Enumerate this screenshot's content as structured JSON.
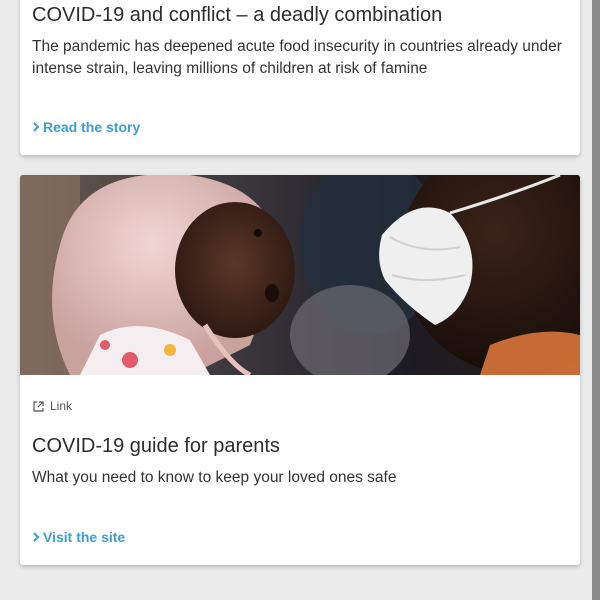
{
  "card_conflict": {
    "title": "COVID-19 and conflict – a deadly combination",
    "description": "The pandemic has deepened acute food insecurity in countries already under intense strain, leaving millions of children at risk of famine",
    "cta_label": "Read the story",
    "cta_icon": "chevron-right-icon"
  },
  "card_guide": {
    "image_icon": "photo",
    "tag_label": "Link",
    "tag_icon": "external-link-icon",
    "title": "COVID-19 guide for parents",
    "description": "What you need to know to keep your loved ones safe",
    "cta_label": "Visit the site",
    "cta_icon": "chevron-right-icon"
  },
  "colors": {
    "background": "#ebebeb",
    "card": "#ffffff",
    "link": "#3c9ed6",
    "text": "#2d2d2d"
  }
}
